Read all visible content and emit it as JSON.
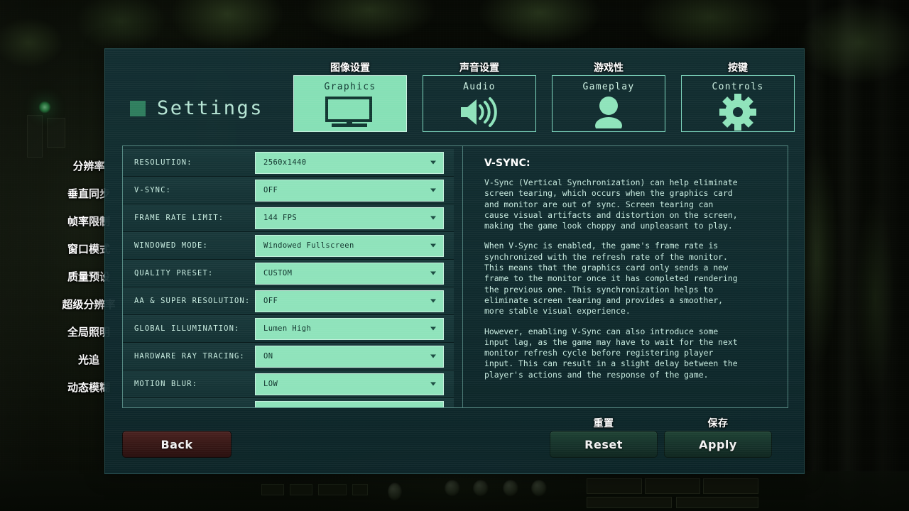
{
  "window": {
    "title": "Settings",
    "title_icon": "green-square-icon"
  },
  "tabs": [
    {
      "label": "Graphics",
      "annotation": "图像设置",
      "icon": "monitor-icon",
      "active": true
    },
    {
      "label": "Audio",
      "annotation": "声音设置",
      "icon": "speaker-icon",
      "active": false
    },
    {
      "label": "Gameplay",
      "annotation": "游戏性",
      "icon": "person-icon",
      "active": false
    },
    {
      "label": "Controls",
      "annotation": "按键",
      "icon": "gear-icon",
      "active": false
    }
  ],
  "settings": [
    {
      "label": "RESOLUTION:",
      "value": "2560x1440",
      "annotation": "分辨率"
    },
    {
      "label": "V-SYNC:",
      "value": "OFF",
      "annotation": "垂直同步"
    },
    {
      "label": "FRAME RATE LIMIT:",
      "value": "144 FPS",
      "annotation": "帧率限制"
    },
    {
      "label": "WINDOWED MODE:",
      "value": "Windowed Fullscreen",
      "annotation": "窗口模式"
    },
    {
      "label": "QUALITY PRESET:",
      "value": "CUSTOM",
      "annotation": "质量预设"
    },
    {
      "label": "AA & SUPER RESOLUTION:",
      "value": "OFF",
      "annotation": "超级分辨率"
    },
    {
      "label": "GLOBAL ILLUMINATION:",
      "value": "Lumen High",
      "annotation": "全局照明"
    },
    {
      "label": "HARDWARE RAY TRACING:",
      "value": "ON",
      "annotation": "光追"
    },
    {
      "label": "MOTION BLUR:",
      "value": "LOW",
      "annotation": "动态模糊"
    },
    {
      "label": "",
      "value": "",
      "annotation": ""
    }
  ],
  "description": {
    "title": "V-SYNC:",
    "paragraphs": [
      "V-Sync (Vertical Synchronization) can help eliminate\nscreen tearing, which occurs when the graphics card\nand monitor are out of sync. Screen tearing can\ncause visual artifacts and distortion on the screen,\nmaking the game look choppy and unpleasant to play.",
      "When V-Sync is enabled, the game's frame rate is\nsynchronized with the refresh rate of the monitor.\nThis means that the graphics card only sends a new\nframe to the monitor once it has completed rendering\nthe previous one. This synchronization helps to\neliminate screen tearing and provides a smoother,\nmore stable visual experience.",
      "However, enabling V-Sync can also introduce some\ninput lag, as the game may have to wait for the next\nmonitor refresh cycle before registering player\ninput. This can result in a slight delay between the\nplayer's actions and the response of the game."
    ]
  },
  "footer": {
    "back": {
      "label": "Back",
      "annotation": ""
    },
    "reset": {
      "label": "Reset",
      "annotation": "重置"
    },
    "apply": {
      "label": "Apply",
      "annotation": "保存"
    }
  },
  "colors": {
    "accent_mint": "#8fe3bb",
    "panel_teal": "#133034",
    "text_light": "#c6e9de",
    "back_button": "#361715",
    "action_button": "#16322a"
  }
}
